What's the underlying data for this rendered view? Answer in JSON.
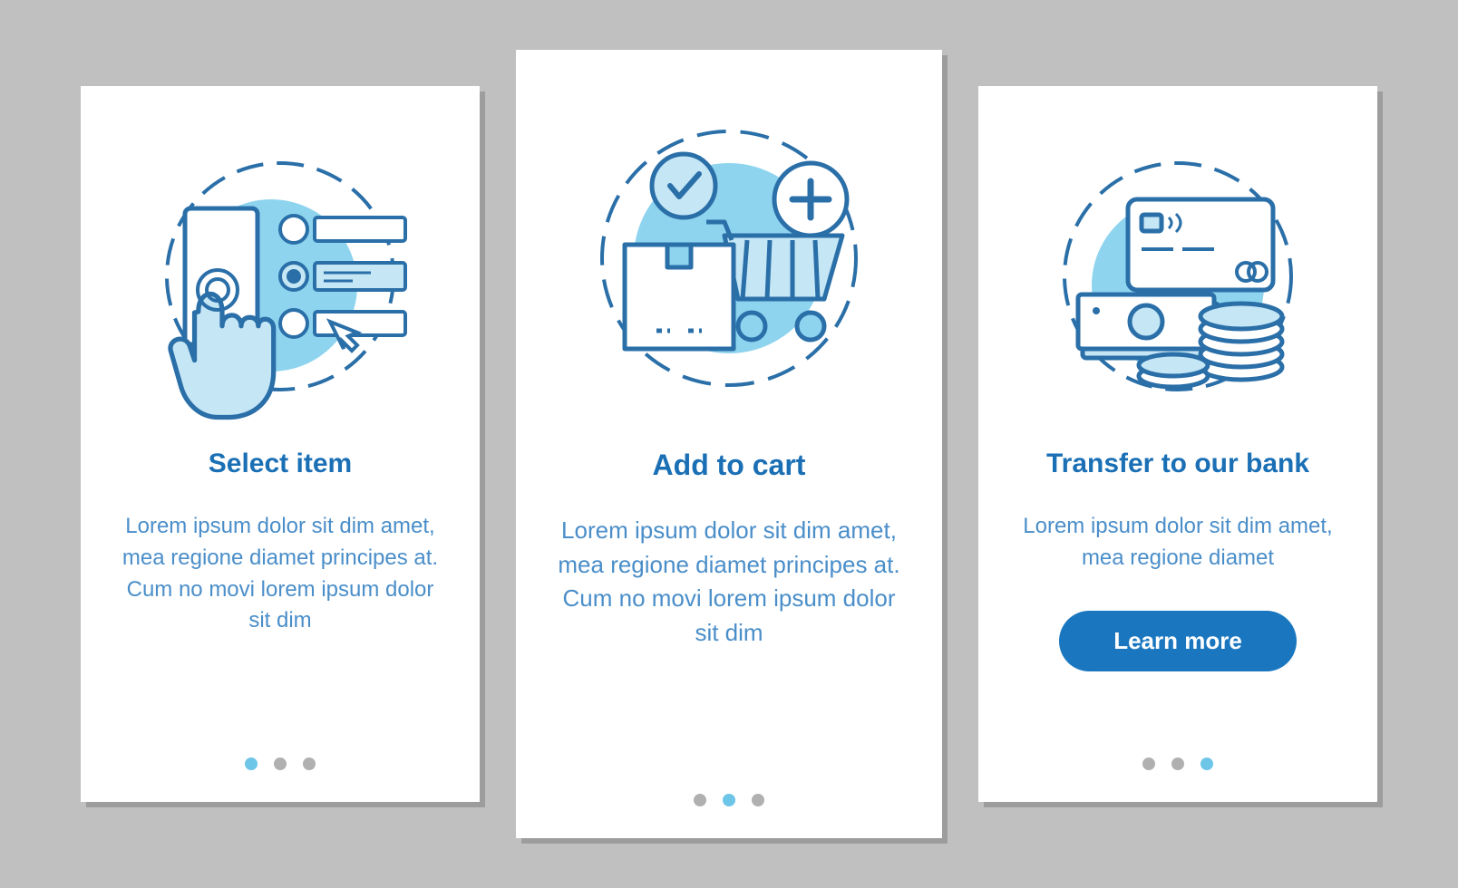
{
  "cards": [
    {
      "title": "Select item",
      "desc": "Lorem ipsum dolor sit dim amet, mea regione diamet principes at. Cum no movi lorem ipsum dolor sit dim",
      "activeDot": 0
    },
    {
      "title": "Add to cart",
      "desc": "Lorem ipsum dolor sit dim amet, mea regione diamet principes at. Cum no movi lorem ipsum dolor sit dim",
      "activeDot": 1
    },
    {
      "title": "Transfer to our bank",
      "desc": "Lorem ipsum dolor sit dim amet, mea regione diamet",
      "button": "Learn more",
      "activeDot": 2
    }
  ],
  "colors": {
    "stroke": "#2a6fa8",
    "fill": "#c5e6f5",
    "accent": "#8fd4ef",
    "bg": "#c0c0c0",
    "brand": "#1a77bf"
  }
}
